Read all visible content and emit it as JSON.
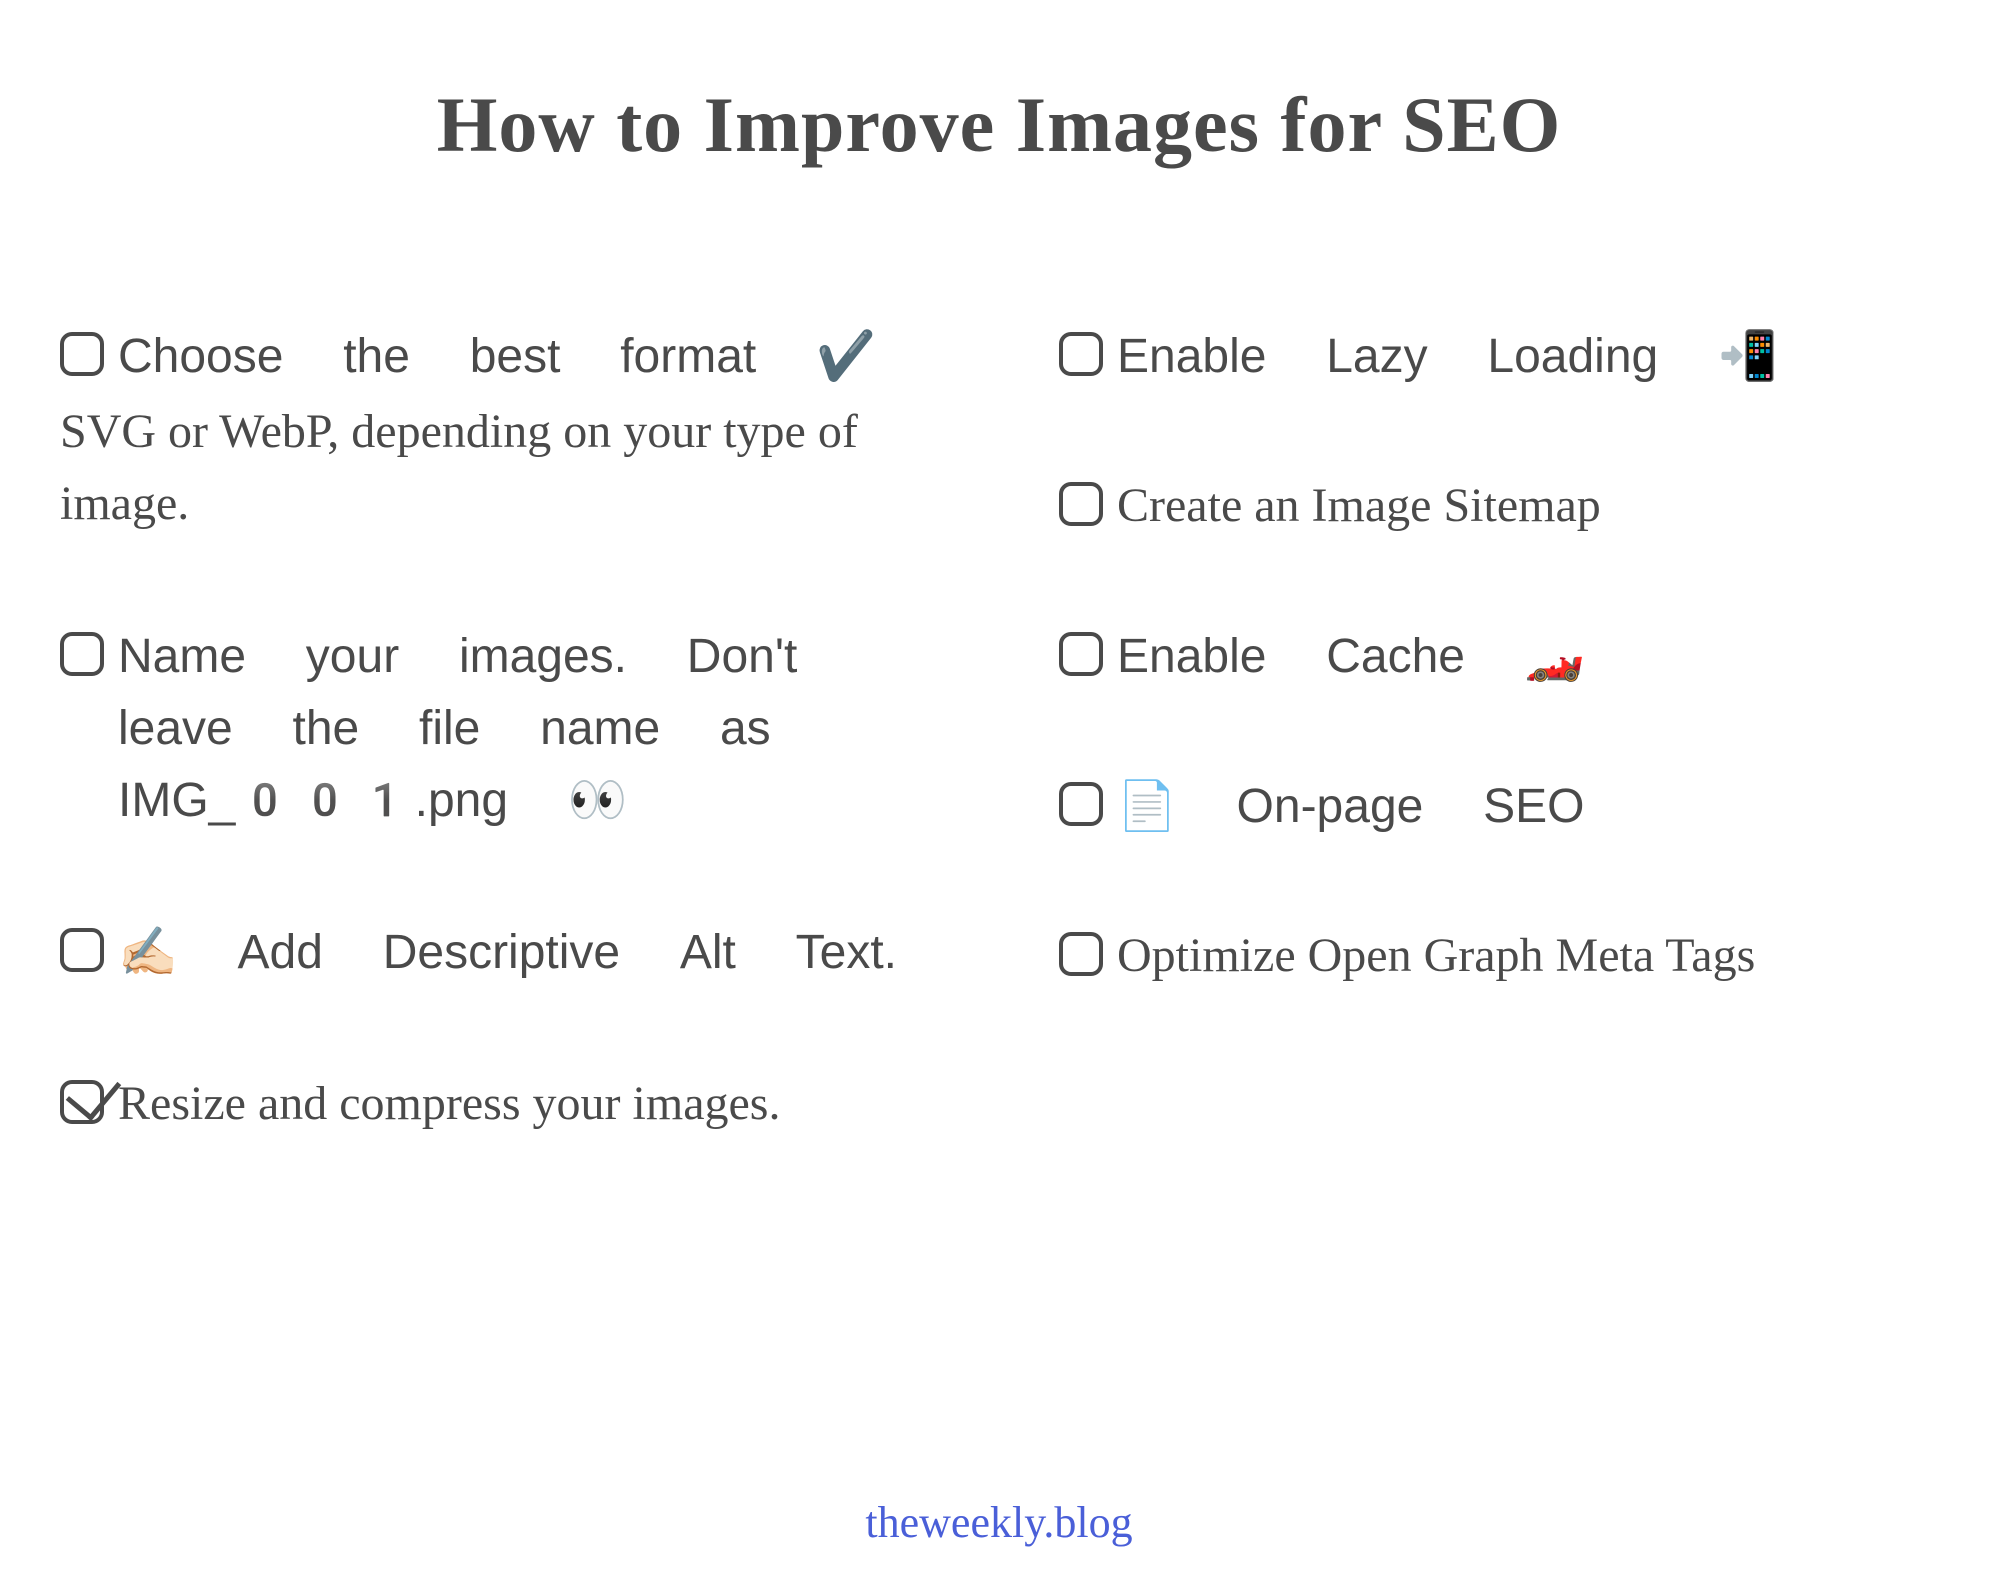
{
  "title": "How to Improve Images for SEO",
  "footer": "theweekly.blog",
  "left": [
    {
      "text": "Choose the best format ✔️",
      "subtext": "SVG or WebP, depending on your type of image.",
      "checked": false
    },
    {
      "text": "Name your images. Don't leave the file name as IMG_001.png 👀",
      "subtext": "",
      "checked": false
    },
    {
      "text": "✍🏻 Add Descriptive Alt Text.",
      "subtext": "",
      "checked": false
    },
    {
      "text": "Resize and compress your images.",
      "subtext": "",
      "checked": true
    }
  ],
  "right": [
    {
      "text": "Enable Lazy Loading 📲",
      "checked": false
    },
    {
      "text": "Create an Image Sitemap",
      "checked": false
    },
    {
      "text": "Enable Cache 🏎️",
      "checked": false
    },
    {
      "text": "📄 On-page SEO",
      "checked": false
    },
    {
      "text": "Optimize Open Graph Meta Tags",
      "checked": false
    }
  ]
}
